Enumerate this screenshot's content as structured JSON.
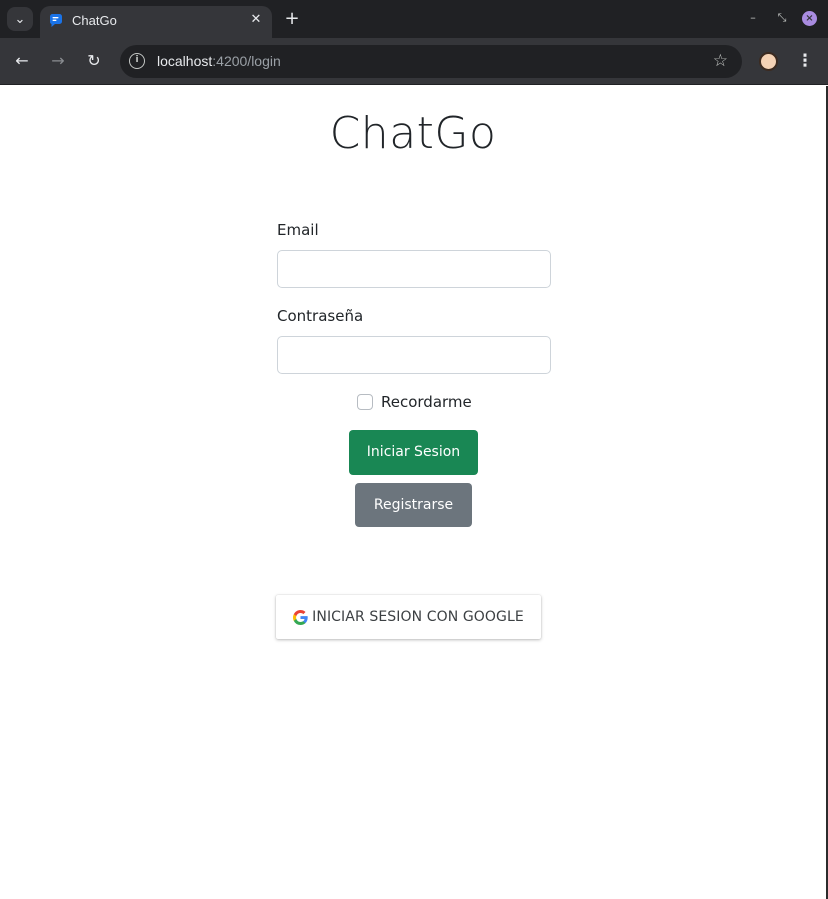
{
  "browser": {
    "tab_title": "ChatGo",
    "url_host": "localhost",
    "url_rest": ":4200/login",
    "tab_close_glyph": "✕",
    "new_tab_glyph": "+",
    "back_glyph": "←",
    "forward_glyph": "→",
    "reload_glyph": "↻",
    "bookmark_glyph": "☆",
    "menu_glyph": "⋮",
    "tab_list_glyph": "⌄",
    "minimize_glyph": "–",
    "maximize_glyph": "⤡",
    "close_glyph": "×",
    "info_glyph": "i",
    "close_button_color": "#a98ce0"
  },
  "page": {
    "title": "ChatGo",
    "email_label": "Email",
    "email_value": "",
    "password_label": "Contraseña",
    "password_value": "",
    "remember_label": "Recordarme",
    "remember_checked": false,
    "login_button": "Iniciar Sesion",
    "register_button": "Registrarse",
    "google_button": "INICIAR SESION CON GOOGLE"
  },
  "colors": {
    "login_button": "#198754",
    "register_button": "#6c757d"
  }
}
